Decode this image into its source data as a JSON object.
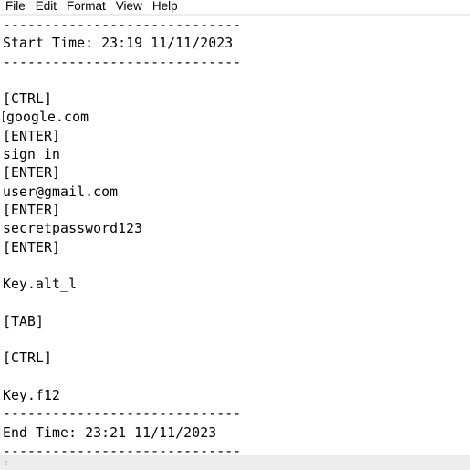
{
  "menu": {
    "items": [
      {
        "label": "File"
      },
      {
        "label": "Edit"
      },
      {
        "label": "Format"
      },
      {
        "label": "View"
      },
      {
        "label": "Help"
      }
    ]
  },
  "document": {
    "lines": [
      "-----------------------------",
      "Start Time: 23:19 11/11/2023",
      "-----------------------------",
      "",
      "[CTRL]",
      "google.com",
      "[ENTER]",
      "sign in",
      "[ENTER]",
      "user@gmail.com",
      "[ENTER]",
      "secretpassword123",
      "[ENTER]",
      "",
      "Key.alt_l",
      "",
      "[TAB]",
      "",
      "[CTRL]",
      "",
      "Key.f12",
      "-----------------------------",
      "End Time: 23:21 11/11/2023",
      "-----------------------------"
    ],
    "unprintable_char_line_index": 5
  },
  "scrollbar": {
    "left_arrow_icon": "‹"
  }
}
